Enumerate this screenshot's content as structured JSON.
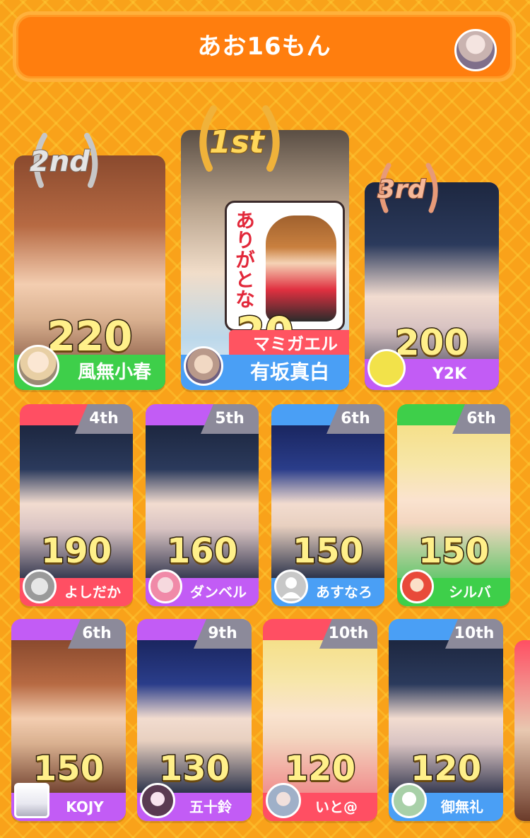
{
  "header": {
    "title": "あお16もん"
  },
  "podium": {
    "first": {
      "badge": "1st",
      "score": "20",
      "name": "有坂真白",
      "comment_tag": "マミガエル",
      "sticker_text": "ありがとな",
      "color": "#4a9ff5"
    },
    "second": {
      "badge": "2nd",
      "score": "220",
      "name": "風無小春",
      "color": "#3ecf4a"
    },
    "third": {
      "badge": "3rd",
      "score": "200",
      "name": "Y2K",
      "color": "#c25cf5"
    }
  },
  "cards": [
    {
      "rank": "4th",
      "score": "190",
      "name": "よしだか",
      "color": "#ff4f63"
    },
    {
      "rank": "5th",
      "score": "160",
      "name": "ダンベル",
      "color": "#c25cf5"
    },
    {
      "rank": "6th",
      "score": "150",
      "name": "あすなろ",
      "color": "#4a9ff5"
    },
    {
      "rank": "6th",
      "score": "150",
      "name": "シルバ",
      "color": "#3ecf4a"
    },
    {
      "rank": "6th",
      "score": "150",
      "name": "KOJY",
      "color": "#c25cf5"
    },
    {
      "rank": "9th",
      "score": "130",
      "name": "五十鈴",
      "color": "#c25cf5"
    },
    {
      "rank": "10th",
      "score": "120",
      "name": "いと@",
      "color": "#ff4f63"
    },
    {
      "rank": "10th",
      "score": "120",
      "name": "御無礼",
      "color": "#4a9ff5"
    }
  ]
}
